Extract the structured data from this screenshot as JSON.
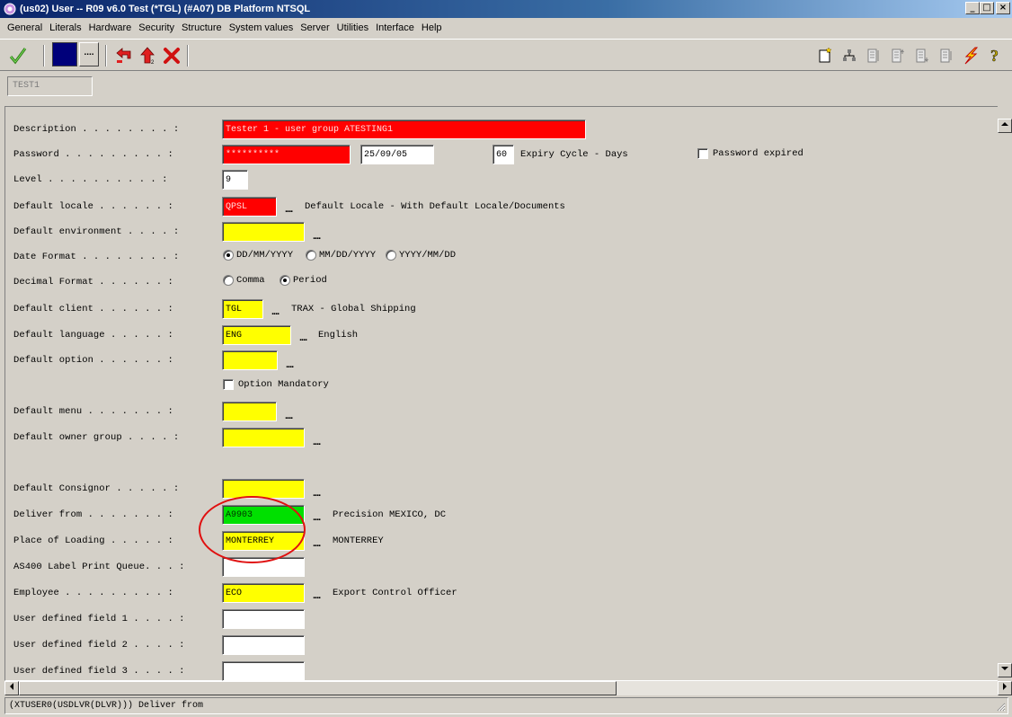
{
  "window": {
    "title": "(us02) User -- R09 v6.0 Test (*TGL) (#A07)    DB Platform NTSQL",
    "buttons": [
      "_",
      "□",
      "×"
    ]
  },
  "menubar": [
    "General",
    "Literals",
    "Hardware",
    "Security",
    "Structure",
    "System values",
    "Server",
    "Utilities",
    "Interface",
    "Help"
  ],
  "toolbar": {
    "left": [
      "check-icon",
      "color-swatch",
      "ellipsis",
      "exit-left-icon",
      "up-arrow-icon",
      "delete-icon"
    ],
    "right": [
      "new-doc-icon",
      "tree-icon",
      "list-a-icon",
      "list-b-icon",
      "list-c-icon",
      "list-d-icon",
      "lightning-icon",
      "help-icon"
    ],
    "dots": "...."
  },
  "user_code": "TEST1",
  "form": {
    "description": {
      "label": "Description . . . . . . . . :",
      "value": "Tester 1 - user group ATESTING1"
    },
    "password": {
      "label": "Password . . . . . . . . . :",
      "value": "**********",
      "date": "25/09/05",
      "cycle": "60",
      "cycle_label": "Expiry Cycle - Days",
      "expired_label": "Password expired"
    },
    "level": {
      "label": "Level . . . . . . . . . . :",
      "value": "9"
    },
    "default_locale": {
      "label": "Default locale . . . . . . :",
      "value": "QPSL",
      "desc": "Default Locale - With Default Locale/Documents"
    },
    "default_environment": {
      "label": "Default environment . . . . :",
      "value": ""
    },
    "date_format": {
      "label": "Date Format . . . . . . . . :",
      "options": [
        "DD/MM/YYYY",
        "MM/DD/YYYY",
        "YYYY/MM/DD"
      ],
      "selected": "DD/MM/YYYY"
    },
    "decimal_format": {
      "label": "Decimal Format . . . . . . :",
      "options": [
        "Comma",
        "Period"
      ],
      "selected": "Period"
    },
    "default_client": {
      "label": "Default client . . . . . . :",
      "value": "TGL",
      "desc": "TRAX - Global Shipping"
    },
    "default_language": {
      "label": "Default language . . . . . :",
      "value": "ENG",
      "desc": "English"
    },
    "default_option": {
      "label": "Default option . . . . . . :",
      "value": "",
      "mandatory_label": "Option Mandatory"
    },
    "default_menu": {
      "label": "Default menu . . . . . . . :",
      "value": ""
    },
    "default_owner_group": {
      "label": "Default owner group . . . . :",
      "value": ""
    },
    "default_consignor": {
      "label": "Default Consignor . . . . . :",
      "value": ""
    },
    "deliver_from": {
      "label": "Deliver from . . . . . . . :",
      "value": "A9903",
      "desc": "Precision MEXICO, DC"
    },
    "place_of_loading": {
      "label": "Place of Loading . . . . . :",
      "value": "MONTERREY",
      "desc": "MONTERREY"
    },
    "as400_queue": {
      "label": "AS400 Label Print Queue. . . :",
      "value": ""
    },
    "employee": {
      "label": "Employee . . . . . . . . . :",
      "value": "ECO",
      "desc": "Export Control Officer"
    },
    "udf1": {
      "label": "User defined field 1 . . . . :",
      "value": ""
    },
    "udf2": {
      "label": "User defined field 2 . . . . :",
      "value": ""
    },
    "udf3": {
      "label": "User defined field 3 . . . . :",
      "value": ""
    }
  },
  "statusbar": "(XTUSER0(USDLVR(DLVR))) Deliver from",
  "colors": {
    "required": "#ff0000",
    "optional": "#ffff00",
    "focused": "#00e000",
    "annotation": "#e01010"
  }
}
